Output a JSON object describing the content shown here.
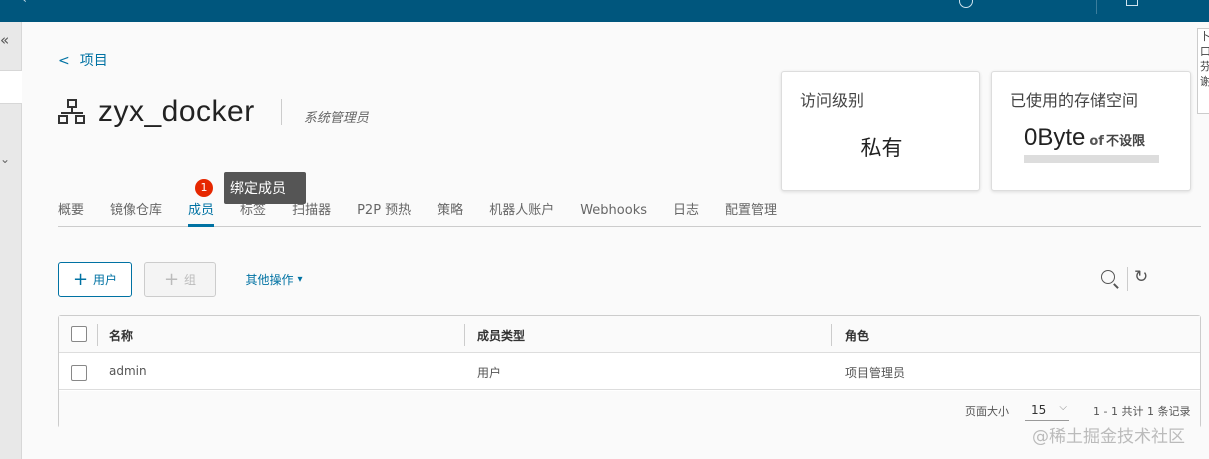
{
  "breadcrumb": {
    "arrow": "<",
    "label": "项目"
  },
  "project": {
    "name": "zyx_docker",
    "role": "系统管理员"
  },
  "cards": {
    "access": {
      "title": "访问级别",
      "value": "私有"
    },
    "storage": {
      "title": "已使用的存储空间",
      "used": "0Byte",
      "of": "of",
      "limit": "不设限",
      "used_fraction": 0
    }
  },
  "tabs": [
    {
      "label": "概要"
    },
    {
      "label": "镜像仓库"
    },
    {
      "label": "成员"
    },
    {
      "label": "标签"
    },
    {
      "label": "扫描器"
    },
    {
      "label": "P2P 预热"
    },
    {
      "label": "策略"
    },
    {
      "label": "机器人账户"
    },
    {
      "label": "Webhooks"
    },
    {
      "label": "日志"
    },
    {
      "label": "配置管理"
    }
  ],
  "active_tab": "成员",
  "tooltip": {
    "badge": "1",
    "text": "绑定成员"
  },
  "toolbar": {
    "add_user": "用户",
    "add_group": "组",
    "more_actions": "其他操作"
  },
  "table": {
    "columns": [
      "名称",
      "成员类型",
      "角色"
    ],
    "rows": [
      {
        "name": "admin",
        "type": "用户",
        "role": "项目管理员"
      }
    ]
  },
  "footer": {
    "page_size_label": "页面大小",
    "page_size": "15",
    "summary": "1 - 1 共计 1 条记录"
  },
  "watermark": "@稀土掘金技术社区",
  "side_panel_text": "卜口芬谢"
}
